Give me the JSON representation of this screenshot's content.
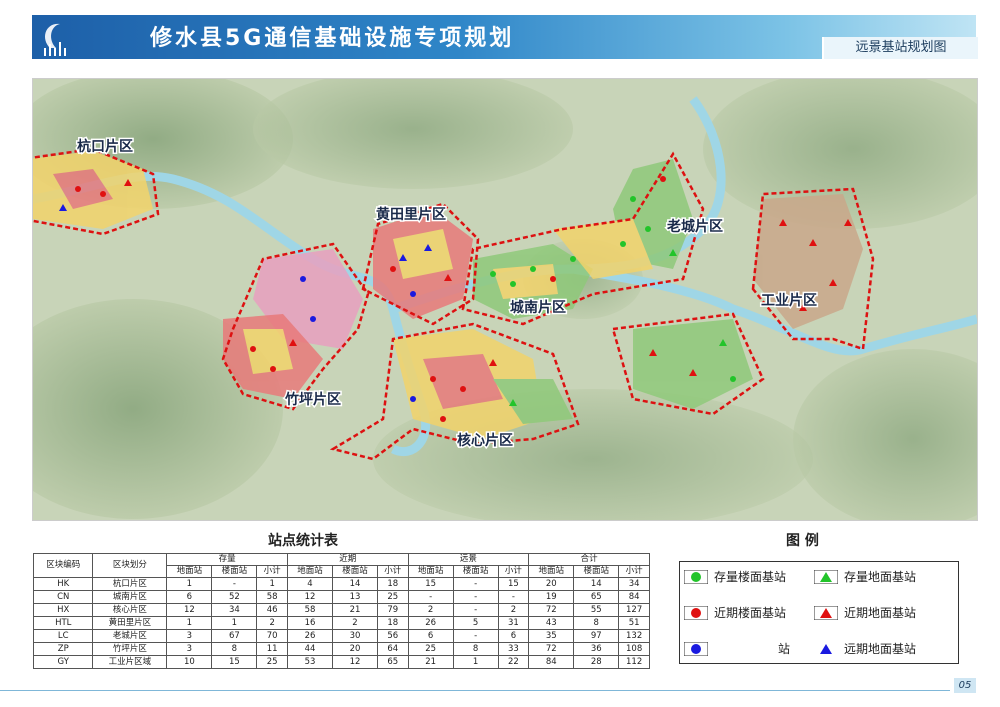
{
  "header": {
    "title": "修水县5G通信基础设施专项规划",
    "subtitle": "远景基站规划图",
    "colors": {
      "band_start": "#1d5fa8",
      "band_end": "#bfe4f4",
      "title_text": "#ffffff"
    }
  },
  "map": {
    "districts": [
      {
        "label": "杭口片区"
      },
      {
        "label": "黄田里片区"
      },
      {
        "label": "老城片区"
      },
      {
        "label": "工业片区"
      },
      {
        "label": "城南片区"
      },
      {
        "label": "竹坪片区"
      },
      {
        "label": "核心片区"
      }
    ]
  },
  "stats": {
    "title": "站点统计表",
    "header_row1": [
      "区块编码",
      "区块划分",
      "存量",
      "近期",
      "远景",
      "合计"
    ],
    "header_row2": [
      "地面站",
      "楼面站",
      "小计",
      "地面站",
      "楼面站",
      "小计",
      "地面站",
      "楼面站",
      "小计",
      "地面站",
      "楼面站",
      "小计"
    ],
    "rows": [
      [
        "HK",
        "杭口片区",
        "1",
        "-",
        "1",
        "4",
        "14",
        "18",
        "15",
        "-",
        "15",
        "20",
        "14",
        "34"
      ],
      [
        "CN",
        "城南片区",
        "6",
        "52",
        "58",
        "12",
        "13",
        "25",
        "-",
        "-",
        "-",
        "19",
        "65",
        "84"
      ],
      [
        "HX",
        "核心片区",
        "12",
        "34",
        "46",
        "58",
        "21",
        "79",
        "2",
        "-",
        "2",
        "72",
        "55",
        "127"
      ],
      [
        "HTL",
        "黄田里片区",
        "1",
        "1",
        "2",
        "16",
        "2",
        "18",
        "26",
        "5",
        "31",
        "43",
        "8",
        "51"
      ],
      [
        "LC",
        "老城片区",
        "3",
        "67",
        "70",
        "26",
        "30",
        "56",
        "6",
        "-",
        "6",
        "35",
        "97",
        "132"
      ],
      [
        "ZP",
        "竹坪片区",
        "3",
        "8",
        "11",
        "44",
        "20",
        "64",
        "25",
        "8",
        "33",
        "72",
        "36",
        "108"
      ],
      [
        "GY",
        "工业片区域",
        "10",
        "15",
        "25",
        "53",
        "12",
        "65",
        "21",
        "1",
        "22",
        "84",
        "28",
        "112"
      ]
    ]
  },
  "legend": {
    "title": "图 例",
    "items": [
      {
        "label": "存量楼面基站",
        "icon": "green-circle-icon",
        "color": "#22c42a"
      },
      {
        "label": "存量地面基站",
        "icon": "green-triangle-icon",
        "color": "#22c42a"
      },
      {
        "label": "近期楼面基站",
        "icon": "red-circle-icon",
        "color": "#e01010"
      },
      {
        "label": "近期地面基站",
        "icon": "red-triangle-icon",
        "color": "#e01010"
      },
      {
        "label": "站",
        "icon": "blue-circle-icon",
        "color": "#1a1ae0"
      },
      {
        "label": "远期地面基站",
        "icon": "blue-triangle-icon",
        "color": "#1a1ae0"
      }
    ]
  },
  "footer": {
    "page": "05"
  }
}
